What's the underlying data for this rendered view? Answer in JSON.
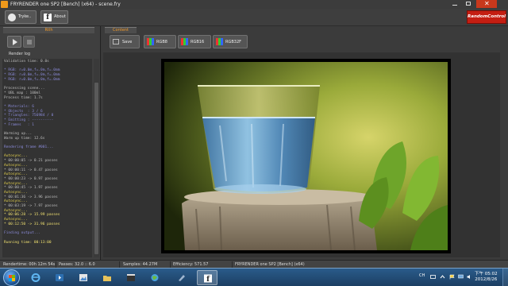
{
  "window": {
    "title": "FRYRENDER one SP2 [Bench] (x64) - scene.fry"
  },
  "toolbar": {
    "buttons": [
      {
        "label": "Tryke..",
        "icon": "sphere-icon"
      },
      {
        "label": "About",
        "icon": "fryrender-f-icon"
      }
    ],
    "brand": "RandomControl"
  },
  "left_panel": {
    "tab": "Rtlh",
    "play_icon": "play-icon",
    "stop_icon": "stop-icon",
    "label": "Render log",
    "log_lines": [
      {
        "text": "Validation time: 0.0s",
        "c": "g"
      },
      {
        "text": "",
        "c": "g"
      },
      {
        "text": "* RGB: r=0.0m,f=.0m,f=.0mm",
        "c": "b"
      },
      {
        "text": "* RGB: r=0.0m,f=.0m,f=.0mm",
        "c": "b"
      },
      {
        "text": "* RGB: r=0.0m,f=.0m,f=.0mm",
        "c": "b"
      },
      {
        "text": "",
        "c": "g"
      },
      {
        "text": "Processing scene...",
        "c": "g"
      },
      {
        "text": "* UBL map : 100ml",
        "c": "g"
      },
      {
        "text": "Process time: 1.7s",
        "c": "g"
      },
      {
        "text": "",
        "c": "g"
      },
      {
        "text": "* Materials: 6",
        "c": "b"
      },
      {
        "text": "* Objects  : 3 / 6",
        "c": "b"
      },
      {
        "text": "* Triangles: 756984 / 0",
        "c": "b"
      },
      {
        "text": "* Emitting : ----------",
        "c": "b"
      },
      {
        "text": "* Frames   : 1",
        "c": "b"
      },
      {
        "text": "",
        "c": "g"
      },
      {
        "text": "Warming up...",
        "c": "g"
      },
      {
        "text": "Warm up time: 12.6s",
        "c": "g"
      },
      {
        "text": "",
        "c": "g"
      },
      {
        "text": "Rendering frame #001...",
        "c": "b"
      },
      {
        "text": "",
        "c": "g"
      },
      {
        "text": "Autosync...",
        "c": "y"
      },
      {
        "text": "* 00:00:05 -> 0.21 passes",
        "c": "g"
      },
      {
        "text": "Autosync...",
        "c": "y"
      },
      {
        "text": "* 00:00:11 -> 0.47 passes",
        "c": "g"
      },
      {
        "text": "Autosync...",
        "c": "y"
      },
      {
        "text": "* 00:00:23 -> 0.97 passes",
        "c": "g"
      },
      {
        "text": "Autosync...",
        "c": "y"
      },
      {
        "text": "* 00:00:45 -> 1.97 passes",
        "c": "g"
      },
      {
        "text": "Autosync...",
        "c": "y"
      },
      {
        "text": "* 00:01:36 -> 3.96 passes",
        "c": "g"
      },
      {
        "text": "Autosync...",
        "c": "y"
      },
      {
        "text": "* 00:03:19 -> 7.97 passes",
        "c": "g"
      },
      {
        "text": "Autosync...",
        "c": "y"
      },
      {
        "text": "* 00:06:28 -> 15.99 passes",
        "c": "w"
      },
      {
        "text": "Autosync...",
        "c": "y"
      },
      {
        "text": "* 00:12:50 -> 31.96 passes",
        "c": "w"
      },
      {
        "text": "",
        "c": "g"
      },
      {
        "text": "Finding output...",
        "c": "b"
      },
      {
        "text": "",
        "c": "g"
      },
      {
        "text": "Running time: 00:13:00",
        "c": "w"
      }
    ]
  },
  "content": {
    "tab": "Content",
    "tools": [
      {
        "label": "Save",
        "icon": "save-icon"
      },
      {
        "label": "RGB8",
        "icon": "rgb-icon"
      },
      {
        "label": "RGB16",
        "icon": "rgb-icon"
      },
      {
        "label": "RGB32F",
        "icon": "rgb-icon"
      }
    ]
  },
  "status": {
    "render_time": "Rendertime: 00h 12m 54s",
    "passes": "Passes: 32.0 :: 6.0",
    "samples": "Samples: 44.27M",
    "efficiency": "Efficiency: 571.57",
    "version": "FRYRENDER one SP2 [Bench] (x64)"
  },
  "taskbar": {
    "time": "下午 05:02",
    "date": "2012/8/26",
    "lang": "CH"
  }
}
